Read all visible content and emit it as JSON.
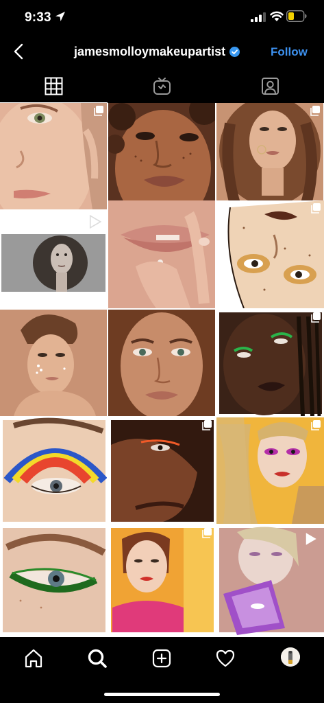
{
  "status_bar": {
    "time": "9:33"
  },
  "header": {
    "username": "jamesmolloymakeupartist",
    "follow_label": "Follow"
  },
  "tabs": [
    "grid-tab",
    "igtv-tab",
    "tagged-tab"
  ],
  "posts": [
    {
      "row": 0,
      "col": 0,
      "badge": "multiple",
      "bg": "#e2b299",
      "subject": "light-skin face closeup"
    },
    {
      "row": 0,
      "col": 1,
      "badge": "none",
      "bg": "#8a5236",
      "subject": "freckled face curly hair"
    },
    {
      "row": 0,
      "col": 2,
      "badge": "multiple",
      "bg": "#c79373",
      "subject": "curly hair portrait"
    },
    {
      "row": 1,
      "col": 0,
      "badge": "video",
      "bg": "#ffffff",
      "subject": "black-and-white portrait"
    },
    {
      "row": 1,
      "col": 1,
      "badge": "none",
      "bg": "#d8a18e",
      "subject": "lips and fingers"
    },
    {
      "row": 1,
      "col": 2,
      "badge": "multiple",
      "bg": "#e9cbb1",
      "subject": "illustrated face"
    },
    {
      "row": 2,
      "col": 0,
      "badge": "none",
      "bg": "#c89274",
      "subject": "updo portrait"
    },
    {
      "row": 2,
      "col": 1,
      "badge": "none",
      "bg": "#ae7456",
      "subject": "freckled face"
    },
    {
      "row": 2,
      "col": 2,
      "badge": "multiple",
      "bg": "#3a2217",
      "subject": "green eyeliner braids"
    },
    {
      "row": 3,
      "col": 0,
      "badge": "none",
      "bg": "#eccdb3",
      "subject": "rainbow eye"
    },
    {
      "row": 3,
      "col": 1,
      "badge": "multiple",
      "bg": "#58301f",
      "subject": "orange liner profile"
    },
    {
      "row": 3,
      "col": 2,
      "badge": "multiple",
      "bg": "#f0b53c",
      "subject": "blonde hair magenta eyes"
    },
    {
      "row": 4,
      "col": 0,
      "badge": "none",
      "bg": "#e6c4ad",
      "subject": "green eyeliner"
    },
    {
      "row": 4,
      "col": 1,
      "badge": "multiple",
      "bg": "#f0a334",
      "subject": "red lips portrait"
    },
    {
      "row": 4,
      "col": 2,
      "badge": "video",
      "bg": "#cb9c92",
      "subject": "purple mirror"
    }
  ],
  "bottom_nav": [
    "home-icon",
    "search-icon",
    "add-post-icon",
    "activity-heart-icon",
    "profile-avatar"
  ],
  "colors": {
    "accent": "#3d91ef",
    "verified": "#3897f0",
    "background": "#000000"
  }
}
